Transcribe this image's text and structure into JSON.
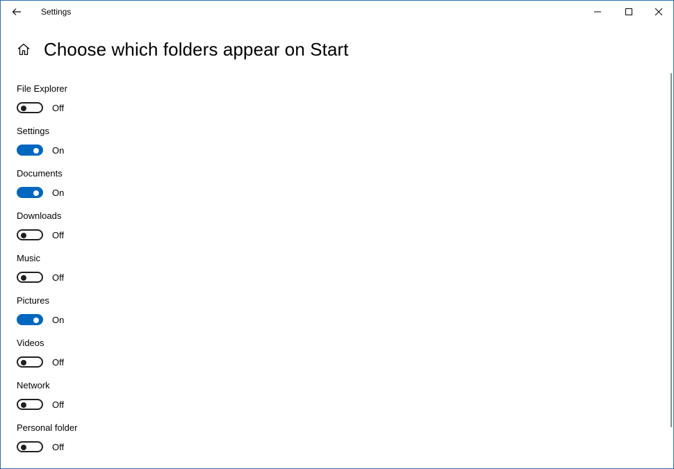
{
  "window": {
    "title": "Settings"
  },
  "page": {
    "title": "Choose which folders appear on Start"
  },
  "colors": {
    "accent": "#0067c0",
    "toggle_off": "#1f1f1f"
  },
  "settings": [
    {
      "label": "File Explorer",
      "on": false,
      "state": "Off"
    },
    {
      "label": "Settings",
      "on": true,
      "state": "On"
    },
    {
      "label": "Documents",
      "on": true,
      "state": "On"
    },
    {
      "label": "Downloads",
      "on": false,
      "state": "Off"
    },
    {
      "label": "Music",
      "on": false,
      "state": "Off"
    },
    {
      "label": "Pictures",
      "on": true,
      "state": "On"
    },
    {
      "label": "Videos",
      "on": false,
      "state": "Off"
    },
    {
      "label": "Network",
      "on": false,
      "state": "Off"
    },
    {
      "label": "Personal folder",
      "on": false,
      "state": "Off"
    }
  ]
}
